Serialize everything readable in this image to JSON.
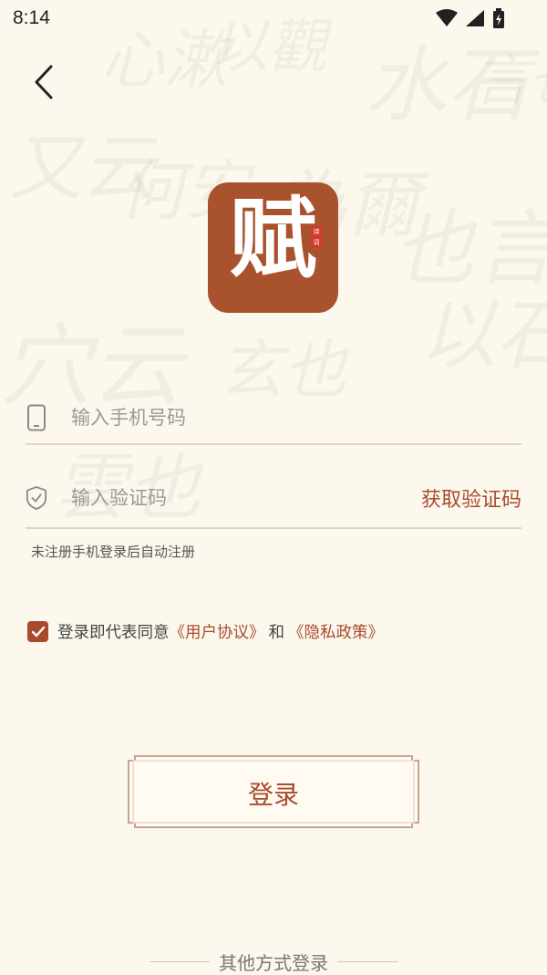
{
  "status_bar": {
    "time": "8:14"
  },
  "logo": {
    "char": "赋",
    "seal": "诗词"
  },
  "form": {
    "phone_placeholder": "输入手机号码",
    "code_placeholder": "输入验证码",
    "get_code_label": "获取验证码",
    "hint": "未注册手机登录后自动注册"
  },
  "agreement": {
    "checked": true,
    "prefix": "登录即代表同意",
    "user_agreement": "《用户协议》",
    "conjunction": "和",
    "privacy_policy": "《隐私政策》"
  },
  "login_label": "登录",
  "other_login_label": "其他方式登录",
  "colors": {
    "accent": "#a84b2c",
    "background": "#fcf8ee",
    "logo_bg": "#a9532e"
  }
}
